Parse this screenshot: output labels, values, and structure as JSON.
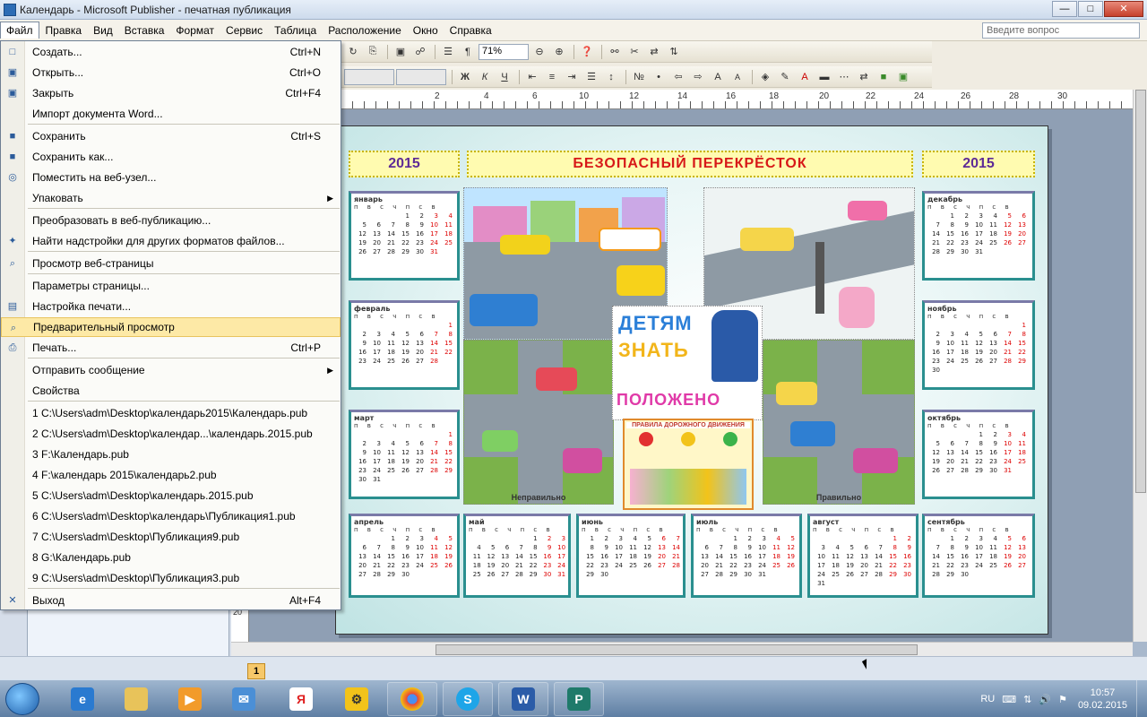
{
  "window": {
    "title": "Календарь - Microsoft Publisher - печатная публикация",
    "ask_placeholder": "Введите вопрос"
  },
  "menubar": {
    "items": [
      "Файл",
      "Правка",
      "Вид",
      "Вставка",
      "Формат",
      "Сервис",
      "Таблица",
      "Расположение",
      "Окно",
      "Справка"
    ]
  },
  "toolbar": {
    "zoom": "71%"
  },
  "ruler": {
    "numbers": [
      "2",
      "4",
      "6",
      "8",
      "10",
      "12",
      "14",
      "16",
      "18",
      "20",
      "22",
      "24",
      "26",
      "28",
      "30"
    ],
    "v_numbers": [
      "20"
    ]
  },
  "file_menu": {
    "items": [
      {
        "label": "Создать...",
        "shortcut": "Ctrl+N",
        "icon": "new-doc-icon"
      },
      {
        "label": "Открыть...",
        "shortcut": "Ctrl+O",
        "icon": "open-folder-icon"
      },
      {
        "label": "Закрыть",
        "shortcut": "Ctrl+F4",
        "icon": "close-folder-icon"
      },
      {
        "label": "Импорт документа Word...",
        "shortcut": "",
        "icon": ""
      },
      {
        "label": "Сохранить",
        "shortcut": "Ctrl+S",
        "icon": "save-icon"
      },
      {
        "label": "Сохранить как...",
        "shortcut": "",
        "icon": "save-as-icon"
      },
      {
        "label": "Поместить на веб-узел...",
        "shortcut": "",
        "icon": "globe-icon"
      },
      {
        "label": "Упаковать",
        "shortcut": "",
        "icon": "",
        "submenu": true
      },
      {
        "label": "Преобразовать в веб-публикацию...",
        "shortcut": "",
        "icon": ""
      },
      {
        "label": "Найти надстройки для других форматов файлов...",
        "shortcut": "",
        "icon": "addins-icon"
      },
      {
        "label": "Просмотр веб-страницы",
        "shortcut": "",
        "icon": "web-preview-icon"
      },
      {
        "label": "Параметры страницы...",
        "shortcut": "",
        "icon": ""
      },
      {
        "label": "Настройка печати...",
        "shortcut": "",
        "icon": "print-setup-icon"
      },
      {
        "label": "Предварительный просмотр",
        "shortcut": "",
        "icon": "print-preview-icon"
      },
      {
        "label": "Печать...",
        "shortcut": "Ctrl+P",
        "icon": "printer-icon"
      },
      {
        "label": "Отправить сообщение",
        "shortcut": "",
        "icon": "",
        "submenu": true
      },
      {
        "label": "Свойства",
        "shortcut": "",
        "icon": ""
      },
      {
        "label": "1 C:\\Users\\adm\\Desktop\\календарь2015\\Календарь.pub",
        "shortcut": "",
        "icon": ""
      },
      {
        "label": "2 C:\\Users\\adm\\Desktop\\календар...\\календарь.2015.pub",
        "shortcut": "",
        "icon": ""
      },
      {
        "label": "3 F:\\Календарь.pub",
        "shortcut": "",
        "icon": ""
      },
      {
        "label": "4 F:\\календарь 2015\\календарь2.pub",
        "shortcut": "",
        "icon": ""
      },
      {
        "label": "5 C:\\Users\\adm\\Desktop\\календарь.2015.pub",
        "shortcut": "",
        "icon": ""
      },
      {
        "label": "6 C:\\Users\\adm\\Desktop\\календарь\\Публикация1.pub",
        "shortcut": "",
        "icon": ""
      },
      {
        "label": "7 C:\\Users\\adm\\Desktop\\Публикация9.pub",
        "shortcut": "",
        "icon": ""
      },
      {
        "label": "8 G:\\Календарь.pub",
        "shortcut": "",
        "icon": ""
      },
      {
        "label": "9 C:\\Users\\adm\\Desktop\\Публикация3.pub",
        "shortcut": "",
        "icon": ""
      },
      {
        "label": "Выход",
        "shortcut": "Alt+F4",
        "icon": "exit-icon"
      }
    ]
  },
  "publication": {
    "year_left": "2015",
    "year_right": "2015",
    "title": "БЕЗОПАСНЫЙ ПЕРЕКРЁСТОК",
    "kids_title": [
      "ДЕТЯМ",
      "ЗНАТЬ",
      "ПОЛОЖЕНО"
    ],
    "rules_title": "ПРАВИЛА ДОРОЖНОГО ДВИЖЕНИЯ",
    "label_wrong": "Неправильно",
    "label_right": "Правильно",
    "months": {
      "jan": {
        "name": "январь",
        "rows": [
          "1 2 3 4",
          "5 6 7 8 9 10 11",
          "12 13 14 15 16 17 18",
          "19 20 21 22 23 24 25",
          "26 27 28 29 30 31"
        ]
      },
      "feb": {
        "name": "февраль",
        "rows": [
          "1",
          "2 3 4 5 6 7 8",
          "9 10 11 12 13 14 15",
          "16 17 18 19 20 21 22",
          "23 24 25 26 27 28"
        ]
      },
      "mar": {
        "name": "март",
        "rows": [
          "1",
          "2 3 4 5 6 7 8",
          "9 10 11 12 13 14 15",
          "16 17 18 19 20 21 22",
          "23 24 25 26 27 28 29",
          "30 31"
        ]
      },
      "apr": {
        "name": "апрель",
        "rows": [
          "1 2 3 4 5",
          "6 7 8 9 10 11 12",
          "13 14 15 16 17 18 19",
          "20 21 22 23 24 25 26",
          "27 28 29 30"
        ]
      },
      "may": {
        "name": "май",
        "rows": [
          "1 2 3",
          "4 5 6 7 8 9 10",
          "11 12 13 14 15 16 17",
          "18 19 20 21 22 23 24",
          "25 26 27 28 29 30 31"
        ]
      },
      "jun": {
        "name": "июнь",
        "rows": [
          "1 2 3 4 5 6 7",
          "8 9 10 11 12 13 14",
          "15 16 17 18 19 20 21",
          "22 23 24 25 26 27 28",
          "29 30"
        ]
      },
      "jul": {
        "name": "июль",
        "rows": [
          "1 2 3 4 5",
          "6 7 8 9 10 11 12",
          "13 14 15 16 17 18 19",
          "20 21 22 23 24 25 26",
          "27 28 29 30 31"
        ]
      },
      "aug": {
        "name": "август",
        "rows": [
          "1 2",
          "3 4 5 6 7 8 9",
          "10 11 12 13 14 15 16",
          "17 18 19 20 21 22 23",
          "24 25 26 27 28 29 30",
          "31"
        ]
      },
      "sep": {
        "name": "сентябрь",
        "rows": [
          "1 2 3 4 5 6",
          "7 8 9 10 11 12 13",
          "14 15 16 17 18 19 20",
          "21 22 23 24 25 26 27",
          "28 29 30"
        ]
      },
      "oct": {
        "name": "октябрь",
        "rows": [
          "1 2 3 4",
          "5 6 7 8 9 10 11",
          "12 13 14 15 16 17 18",
          "19 20 21 22 23 24 25",
          "26 27 28 29 30 31"
        ]
      },
      "nov": {
        "name": "ноябрь",
        "rows": [
          "1",
          "2 3 4 5 6 7 8",
          "9 10 11 12 13 14 15",
          "16 17 18 19 20 21 22",
          "23 24 25 26 27 28 29",
          "30"
        ]
      },
      "dec": {
        "name": "декабрь",
        "rows": [
          "1 2 3 4 5 6",
          "7 8 9 10 11 12 13",
          "14 15 16 17 18 19 20",
          "21 22 23 24 25 26 27",
          "28 29 30 31"
        ]
      }
    },
    "weekday_header": "п в с ч п с в"
  },
  "status": {
    "page_number": "1"
  },
  "taskbar": {
    "lang": "RU",
    "time": "10:57",
    "date": "09.02.2015"
  }
}
